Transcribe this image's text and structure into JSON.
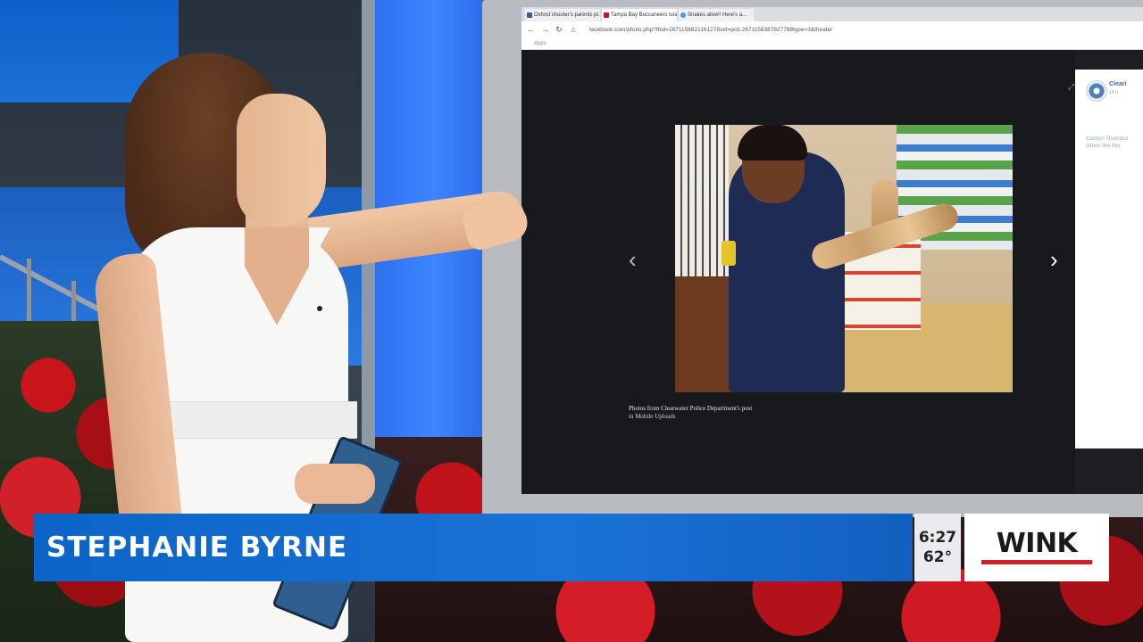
{
  "browser": {
    "tabs": [
      "Oxford shooter's parents pl...",
      "Tampa Bay Buccaneers coac...",
      "Snakes alive!! Here's a..."
    ],
    "url": "facebook.com/photo.php?fbid=2671156821161278set=pcb.2671158387827788type=3&theater",
    "bookmarks": "Apps",
    "caption_line1": "Photos from Clearwater Police Department's post",
    "caption_line2": "in Mobile Uploads",
    "side_panel": {
      "name": "Cleari",
      "time": "14 h",
      "text_line1": "Carolyn Thompso",
      "text_line2": "others like this"
    }
  },
  "lower_third": {
    "name": "STEPHANIE BYRNE",
    "time": "6:27",
    "temperature": "62°",
    "logo": "WINK"
  },
  "colors": {
    "banner": "#1a72d6",
    "logo_bar": "#d41f2b"
  }
}
